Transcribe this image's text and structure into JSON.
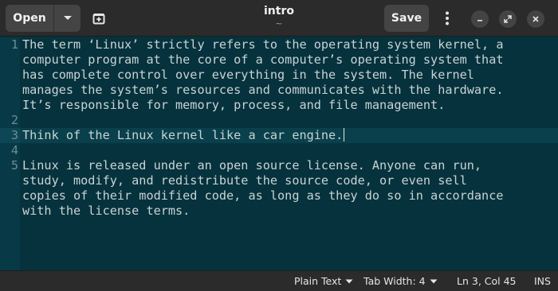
{
  "header": {
    "open_label": "Open",
    "title": "intro",
    "subtitle": "~",
    "save_label": "Save"
  },
  "icons": {
    "open_menu": "chevron-down-icon",
    "new_tab": "new-tab-icon",
    "main_menu": "kebab-menu-icon",
    "minimize": "minimize-icon",
    "maximize": "maximize-icon",
    "close": "close-icon"
  },
  "colors": {
    "editor_background": "#06323d",
    "headerbar": "#2b2b2b",
    "text": "#c8d3d5"
  },
  "editor": {
    "current_line": 3,
    "rows": [
      {
        "ln": "1",
        "text": "The term ‘Linux’ strictly refers to the operating system kernel, a"
      },
      {
        "ln": "",
        "text": "computer program at the core of a computer’s operating system that"
      },
      {
        "ln": "",
        "text": "has complete control over everything in the system. The kernel"
      },
      {
        "ln": "",
        "text": "manages the system’s resources and communicates with the hardware."
      },
      {
        "ln": "",
        "text": "It’s responsible for memory, process, and file management."
      },
      {
        "ln": "2",
        "text": ""
      },
      {
        "ln": "3",
        "text": "Think of the Linux kernel like a car engine."
      },
      {
        "ln": "4",
        "text": ""
      },
      {
        "ln": "5",
        "text": "Linux is released under an open source license. Anyone can run,"
      },
      {
        "ln": "",
        "text": "study, modify, and redistribute the source code, or even sell"
      },
      {
        "ln": "",
        "text": "copies of their modified code, as long as they do so in accordance"
      },
      {
        "ln": "",
        "text": "with the license terms."
      }
    ]
  },
  "statusbar": {
    "language": "Plain Text",
    "tab_width": "Tab Width: 4",
    "position": "Ln 3, Col 45",
    "mode": "INS"
  }
}
